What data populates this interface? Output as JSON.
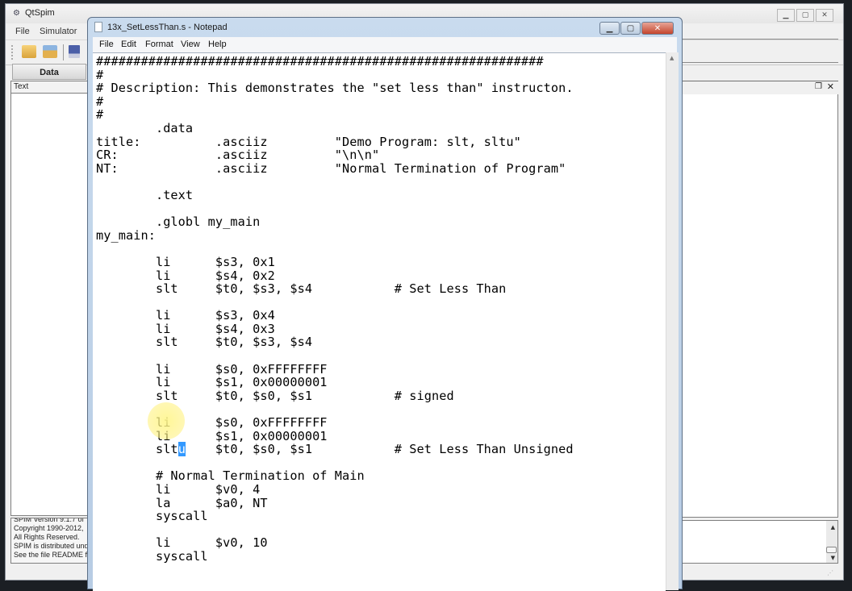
{
  "qtspim": {
    "title": "QtSpim",
    "menu": [
      "File",
      "Simulator"
    ],
    "toolbar": {
      "icons": [
        "open-folder-icon",
        "reload-folder-icon",
        "save-icon"
      ]
    },
    "tabs": [
      "Data"
    ],
    "left_panel_header": "Text",
    "console_lines": [
      "SPIM Version 9.1.7 of",
      "Copyright 1990-2012,",
      "All Rights Reserved.",
      "SPIM is distributed und",
      "See the file README fo"
    ],
    "dock_float_glyph": "❐",
    "dock_close_glyph": "✕",
    "caption": {
      "minimize": "▁",
      "maximize": "▢",
      "close": "✕"
    }
  },
  "notepad": {
    "title": "13x_SetLessThan.s - Notepad",
    "menu": [
      "File",
      "Edit",
      "Format",
      "View",
      "Help"
    ],
    "caption": {
      "minimize": "▁",
      "maximize": "▢",
      "close": "✕"
    },
    "selected_char_line": 29,
    "lines": [
      "############################################################",
      "#",
      "# Description: This demonstrates the \"set less than\" instructon.",
      "#",
      "#",
      "        .data",
      "title:          .asciiz         \"Demo Program: slt, sltu\"",
      "CR:             .asciiz         \"\\n\\n\"",
      "NT:             .asciiz         \"Normal Termination of Program\"",
      "",
      "        .text",
      "",
      "        .globl my_main",
      "my_main:",
      "",
      "        li      $s3, 0x1",
      "        li      $s4, 0x2",
      "        slt     $t0, $s3, $s4           # Set Less Than",
      "",
      "        li      $s3, 0x4",
      "        li      $s4, 0x3",
      "        slt     $t0, $s3, $s4",
      "",
      "        li      $s0, 0xFFFFFFFF",
      "        li      $s1, 0x00000001",
      "        slt     $t0, $s0, $s1           # signed",
      "",
      "        li      $s0, 0xFFFFFFFF",
      "        li      $s1, 0x00000001",
      "        slt",
      "",
      "        # Normal Termination of Main",
      "        li      $v0, 4",
      "        la      $a0, NT",
      "        syscall",
      "",
      "        li      $v0, 10",
      "        syscall"
    ],
    "line29_selected": "u",
    "line29_rest": "    $t0, $s0, $s1           # Set Less Than Unsigned"
  }
}
